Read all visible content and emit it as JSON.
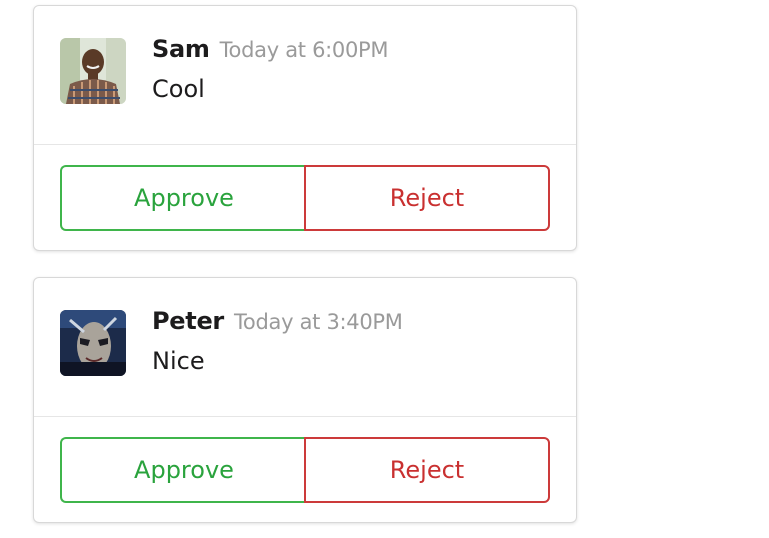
{
  "messages": [
    {
      "author": "Sam",
      "time": "Today at 6:00PM",
      "text": "Cool",
      "approve_label": "Approve",
      "reject_label": "Reject"
    },
    {
      "author": "Peter",
      "time": "Today at 3:40PM",
      "text": "Nice",
      "approve_label": "Approve",
      "reject_label": "Reject"
    }
  ],
  "colors": {
    "approve": "#2aa33d",
    "reject": "#c93030",
    "time": "#9a9a9a"
  },
  "icons": [
    "sam-avatar",
    "peter-avatar"
  ]
}
